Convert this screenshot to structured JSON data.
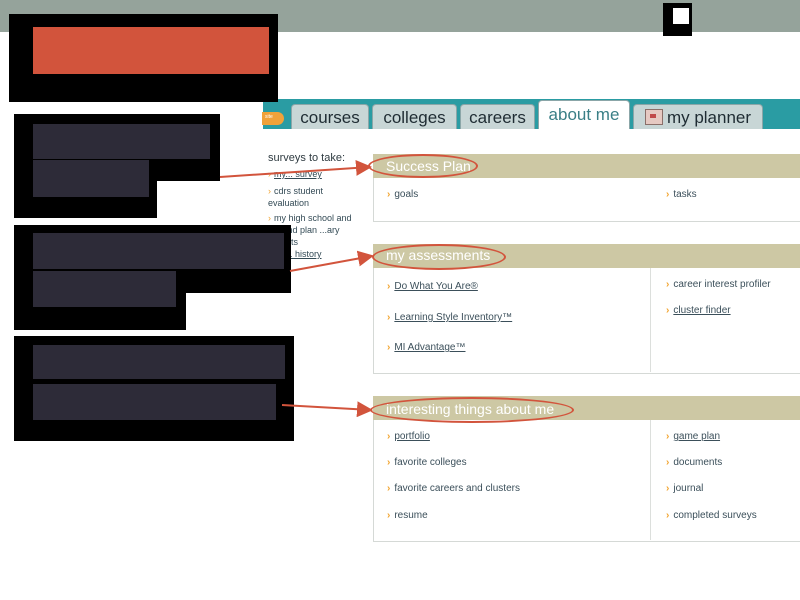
{
  "colors": {
    "accent_orange": "#f2a531",
    "annotation_red": "#d2543c",
    "tab_teal": "#2a9ca3",
    "section_header": "#cdc8a4",
    "topbar": "#95a39b"
  },
  "tabs": {
    "partial_label": "site",
    "courses": "courses",
    "colleges": "colleges",
    "careers": "careers",
    "about_me": "about me",
    "my_planner": "my planner",
    "planner_icon": "planner-icon"
  },
  "left_panel": {
    "heading": "surveys to take:",
    "items": [
      {
        "text": "my... survey"
      },
      {
        "text": "cdrs student evaluation"
      },
      {
        "text": "my high school and beyond plan ...ary formats"
      },
      {
        "text": "... history"
      }
    ]
  },
  "sections": {
    "success_plan": {
      "title": "Success Plan",
      "left": [
        "goals"
      ],
      "right": [
        "tasks"
      ]
    },
    "my_assessments": {
      "title": "my assessments",
      "left": [
        "Do What You Are®",
        "Learning Style Inventory™",
        "MI Advantage™"
      ],
      "right": [
        "career interest profiler",
        "cluster finder"
      ]
    },
    "interesting": {
      "title": "interesting things about me",
      "left": [
        "portfolio",
        "favorite colleges",
        "favorite careers and clusters",
        "resume"
      ],
      "right": [
        "game plan",
        "documents",
        "journal",
        "completed surveys"
      ]
    }
  }
}
